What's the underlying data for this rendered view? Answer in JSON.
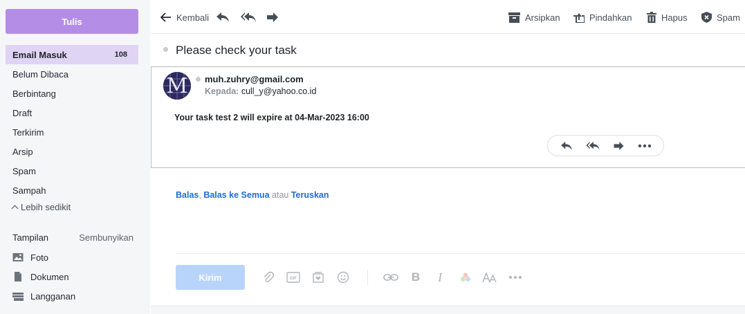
{
  "sidebar": {
    "compose_label": "Tulis",
    "items": [
      {
        "label": "Email Masuk",
        "count": "108"
      },
      {
        "label": "Belum Dibaca"
      },
      {
        "label": "Berbintang"
      },
      {
        "label": "Draft"
      },
      {
        "label": "Terkirim"
      },
      {
        "label": "Arsip"
      },
      {
        "label": "Spam"
      },
      {
        "label": "Sampah"
      }
    ],
    "less_label": "Lebih sedikit",
    "views_title": "Tampilan",
    "views_hide": "Sembunyikan",
    "views": [
      {
        "label": "Foto",
        "icon": "photo-icon"
      },
      {
        "label": "Dokumen",
        "icon": "document-icon"
      },
      {
        "label": "Langganan",
        "icon": "subscription-icon"
      }
    ],
    "accent": "#b48ee6"
  },
  "toolbar": {
    "back_label": "Kembali",
    "archive_label": "Arsipkan",
    "move_label": "Pindahkan",
    "delete_label": "Hapus",
    "spam_label": "Spam"
  },
  "message": {
    "subject": "Please check your task",
    "sender": "muh.zuhry@gmail.com",
    "to_label": "Kepada:",
    "to_value": "cull_y@yahoo.co.id",
    "avatar_letter": "M",
    "body": "Your task test 2 will expire at 04-Mar-2023 16:00"
  },
  "reply": {
    "reply_label": "Balas",
    "comma": ",",
    "reply_all_label": "Balas ke Semua",
    "or_label": "atau",
    "forward_label": "Teruskan",
    "send_label": "Kirim",
    "link_color": "#1e6bd6"
  }
}
